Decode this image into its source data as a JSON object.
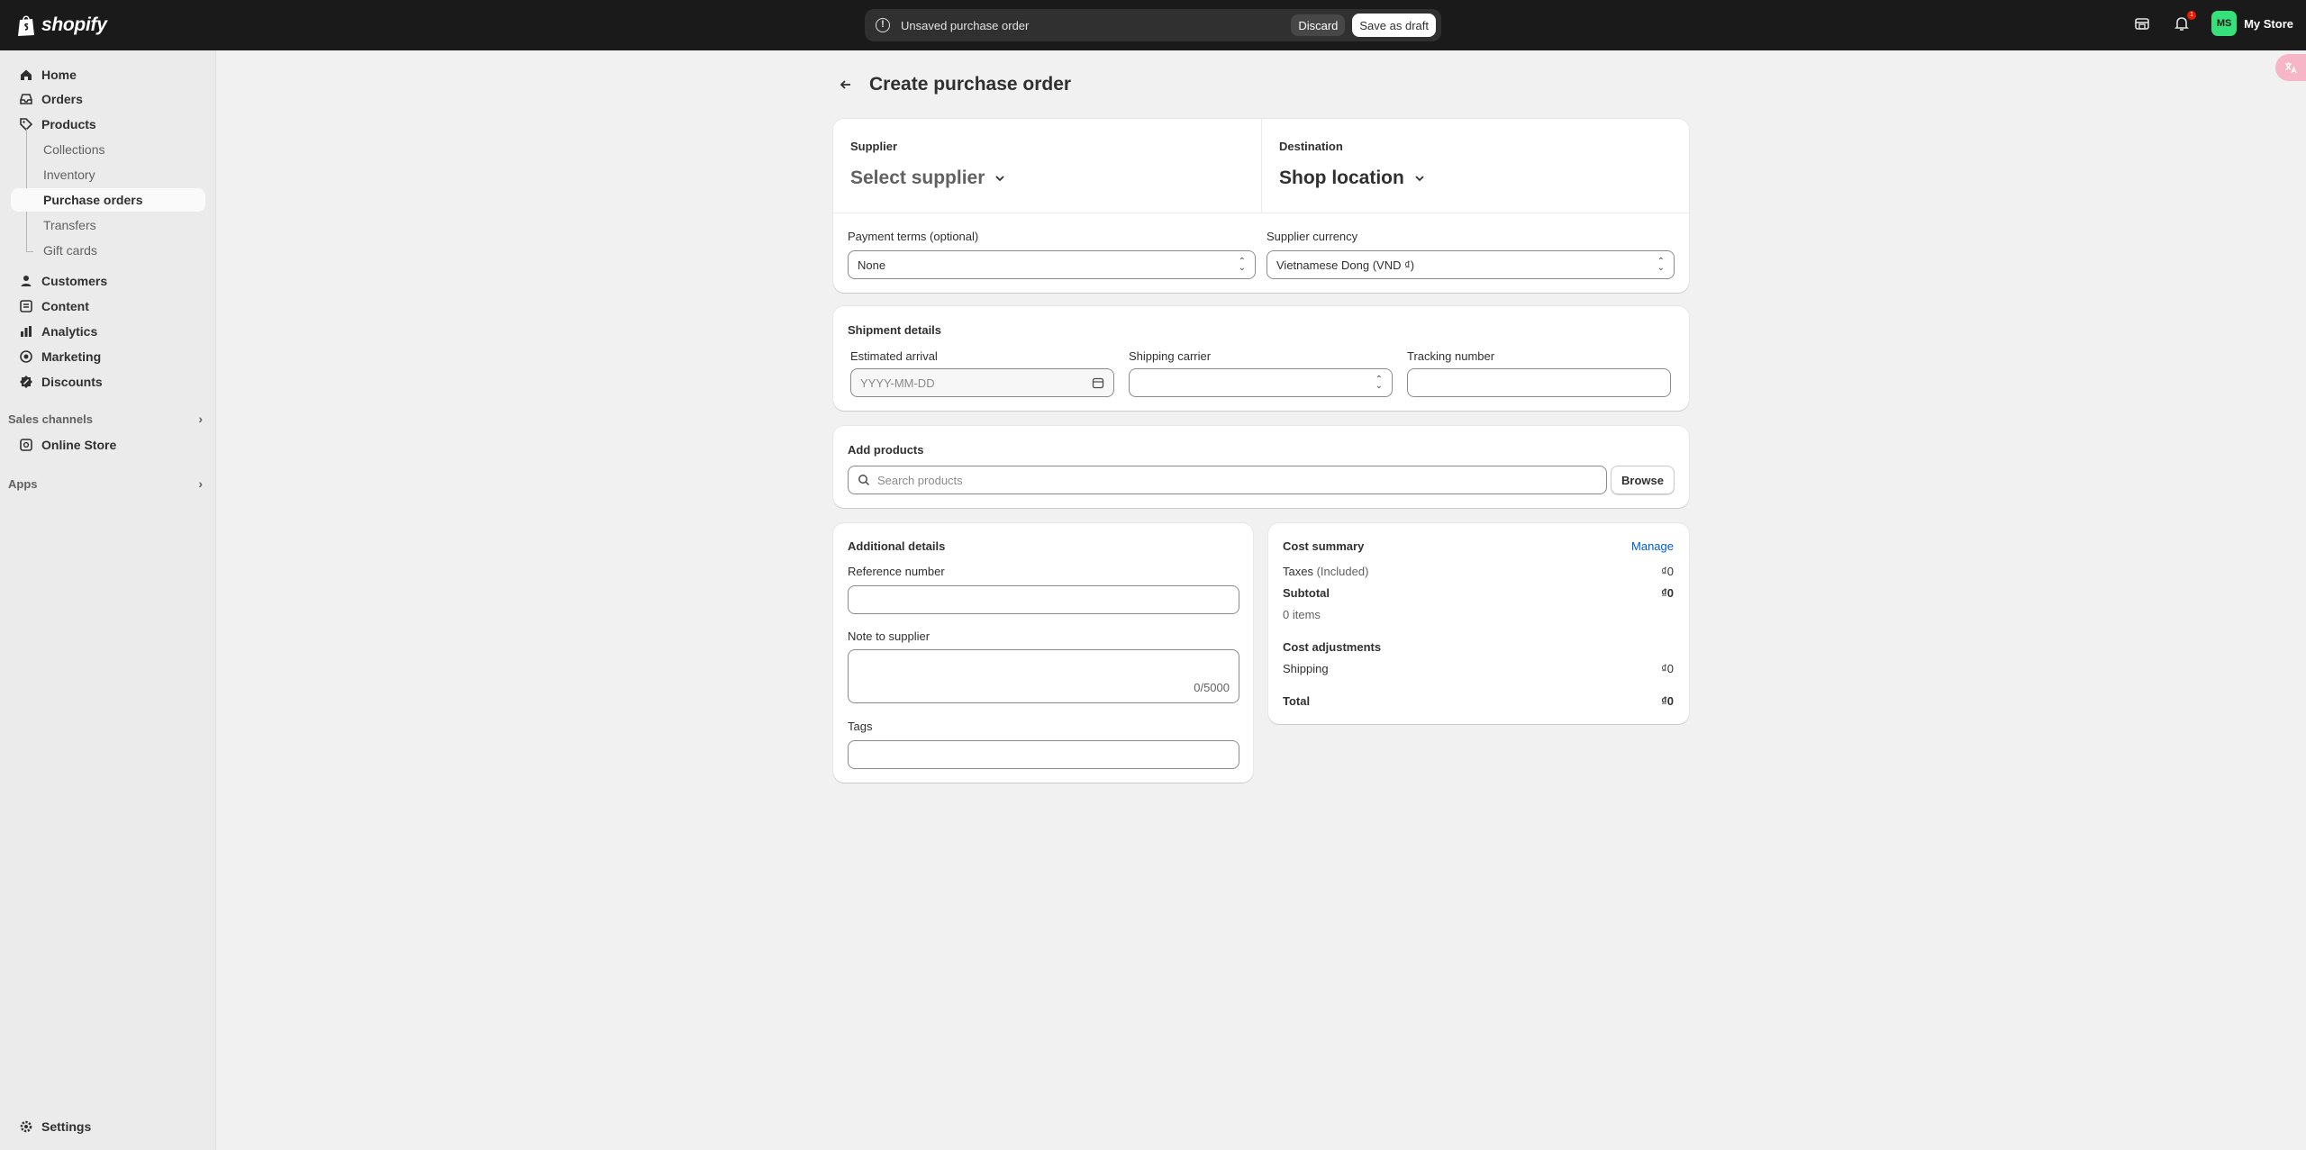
{
  "topbar": {
    "logo_text": "shopify",
    "unsaved_text": "Unsaved purchase order",
    "discard_label": "Discard",
    "save_label": "Save as draft",
    "notification_count": "1",
    "avatar_initials": "MS",
    "store_name": "My Store"
  },
  "sidebar": {
    "home": "Home",
    "orders": "Orders",
    "products": "Products",
    "collections": "Collections",
    "inventory": "Inventory",
    "purchase_orders": "Purchase orders",
    "transfers": "Transfers",
    "gift_cards": "Gift cards",
    "customers": "Customers",
    "content": "Content",
    "analytics": "Analytics",
    "marketing": "Marketing",
    "discounts": "Discounts",
    "sales_channels": "Sales channels",
    "online_store": "Online Store",
    "apps": "Apps",
    "settings": "Settings"
  },
  "page": {
    "title": "Create purchase order"
  },
  "supplier": {
    "label": "Supplier",
    "value": "Select supplier"
  },
  "destination": {
    "label": "Destination",
    "value": "Shop location"
  },
  "payment_terms": {
    "label": "Payment terms (optional)",
    "value": "None"
  },
  "currency": {
    "label": "Supplier currency",
    "value": "Vietnamese Dong (VND ₫)"
  },
  "shipment": {
    "title": "Shipment details",
    "arrival_label": "Estimated arrival",
    "arrival_placeholder": "YYYY-MM-DD",
    "carrier_label": "Shipping carrier",
    "tracking_label": "Tracking number"
  },
  "add_products": {
    "title": "Add products",
    "search_placeholder": "Search products",
    "browse_label": "Browse"
  },
  "additional": {
    "title": "Additional details",
    "reference_label": "Reference number",
    "note_label": "Note to supplier",
    "note_counter": "0/5000",
    "tags_label": "Tags"
  },
  "cost_summary": {
    "title": "Cost summary",
    "manage": "Manage",
    "taxes_label": "Taxes",
    "taxes_note": "(Included)",
    "taxes_value": "₫0",
    "subtotal_label": "Subtotal",
    "subtotal_value": "₫0",
    "items": "0 items",
    "adjustments_title": "Cost adjustments",
    "shipping_label": "Shipping",
    "shipping_value": "₫0",
    "total_label": "Total",
    "total_value": "₫0"
  }
}
